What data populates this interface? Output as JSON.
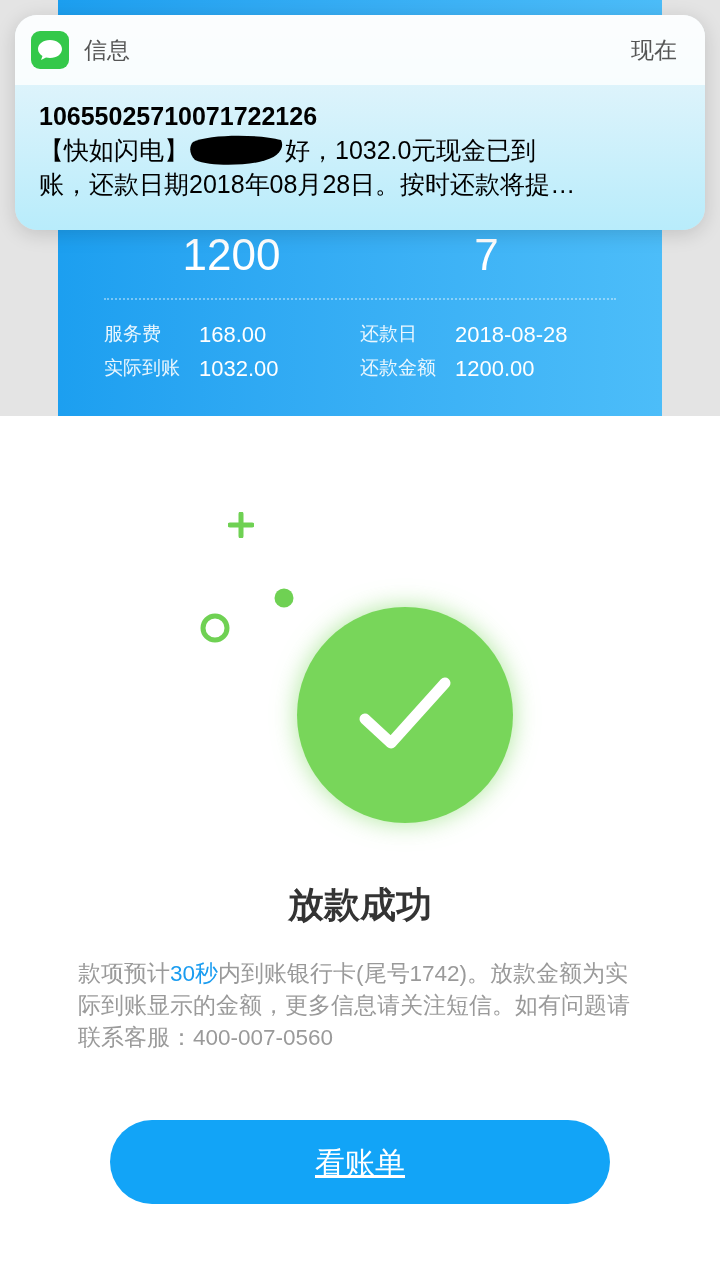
{
  "notification": {
    "app": "信息",
    "time": "现在",
    "sender": "10655025710071722126",
    "message_prefix": "【快如闪电】",
    "redacted": true,
    "message_lines": [
      "好，1032.0元现金已到",
      "账，还款日期2018年08月28日。按时还款将提…"
    ]
  },
  "loan_card": {
    "amount": "1200",
    "days": "7",
    "details": [
      {
        "label": "服务费",
        "value": "168.00"
      },
      {
        "label": "还款日",
        "value": "2018-08-28"
      },
      {
        "label": "实际到账",
        "value": "1032.00"
      },
      {
        "label": "还款金额",
        "value": "1200.00"
      }
    ]
  },
  "result": {
    "title": "放款成功",
    "description": "款项预计**30秒**内到账银行卡(尾号1742)。放款金额为实际到账显示的金额，更多信息请关注短信。如有问题请联系客服：400-007-0560",
    "button": "看账单"
  }
}
